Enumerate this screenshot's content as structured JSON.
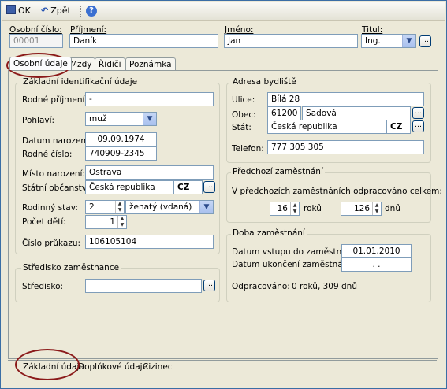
{
  "toolbar": {
    "ok_label": "OK",
    "back_label": "Zpět",
    "help_label": "?"
  },
  "header": {
    "id_label": "Osobní číslo:",
    "id_value": "00001",
    "surname_label": "Příjmení:",
    "surname_value": "Daník",
    "firstname_label": "Jméno:",
    "firstname_value": "Jan",
    "title_label": "Titul:",
    "title_value": "Ing."
  },
  "tabs": [
    "Osobní údaje",
    "Mzdy",
    "Řidiči",
    "Poznámka"
  ],
  "basic": {
    "group_title": "Základní identifikační údaje",
    "maiden_label": "Rodné příjmení:",
    "maiden_value": "-",
    "sex_label": "Pohlaví:",
    "sex_value": "muž",
    "dob_label": "Datum narození:",
    "dob_value": "09.09.1974",
    "birthno_label": "Rodné číslo:",
    "birthno_value": "740909-2345",
    "pob_label": "Místo narození:",
    "pob_value": "Ostrava",
    "citizenship_label": "Státní občanství:",
    "citizenship_value": "Česká republika",
    "citizenship_code": "CZ",
    "marital_label": "Rodinný stav:",
    "marital_code": "2",
    "marital_value": "ženatý (vdaná)",
    "children_label": "Počet dětí:",
    "children_value": "1",
    "idcard_label": "Číslo průkazu:",
    "idcard_value": "106105104"
  },
  "center": {
    "group_title": "Středisko zaměstnance",
    "center_label": "Středisko:",
    "center_value": ""
  },
  "address": {
    "group_title": "Adresa bydliště",
    "street_label": "Ulice:",
    "street_value": "Bílá 28",
    "city_label": "Obec:",
    "zip_value": "61200",
    "city_value": "Sadová",
    "state_label": "Stát:",
    "state_value": "Česká republika",
    "state_code": "CZ",
    "phone_label": "Telefon:",
    "phone_value": "777 305 305"
  },
  "prev": {
    "group_title": "Předchozí zaměstnání",
    "text": "V předchozích zaměstnáních odpracováno celkem:",
    "years_value": "16",
    "years_unit": "roků",
    "days_value": "126",
    "days_unit": "dnů"
  },
  "employment": {
    "group_title": "Doba zaměstnání",
    "start_label": "Datum vstupu do zaměstnání:",
    "start_value": "01.01.2010",
    "end_label": "Datum ukončení zaměstnání:",
    "end_value": ". .",
    "worked_label": "Odpracováno:",
    "worked_value": "0 roků, 309 dnů"
  },
  "bottom_tabs": [
    "Základní údaje",
    "Doplňkové údaje",
    "Cizinec"
  ]
}
